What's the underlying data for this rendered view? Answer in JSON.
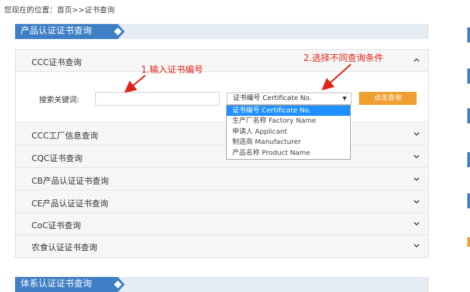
{
  "breadcrumb": {
    "prefix": "您现在的位置：",
    "home": "首页",
    "separator": ">>",
    "current": "证书查询"
  },
  "sections": {
    "product": "产品认证证书查询",
    "system": "体系认证证书查询"
  },
  "accordion": {
    "items": [
      {
        "label": "CCC证书查询",
        "expanded": true
      },
      {
        "label": "CCC工厂信息查询",
        "expanded": false
      },
      {
        "label": "CQC证书查询",
        "expanded": false
      },
      {
        "label": "CB产品认证证书查询",
        "expanded": false
      },
      {
        "label": "CE产品认证证书查询",
        "expanded": false
      },
      {
        "label": "CoC证书查询",
        "expanded": false
      },
      {
        "label": "农食认证证书查询",
        "expanded": false
      }
    ]
  },
  "search": {
    "keyword_label": "搜索关键词:",
    "keyword_value": "",
    "select_value": "证书编号 Certificate No.",
    "button_label": "点击查询",
    "options": [
      "证书编号 Certificate No.",
      "生产厂名称 Factory Name",
      "申请人 Applicant",
      "制造商 Manufacturer",
      "产品名称 Product Name"
    ]
  },
  "annotations": {
    "step1": "1.输入证书编号",
    "step2": "2.选择不同查询条件"
  },
  "colors": {
    "accent_blue": "#3f7fc5",
    "section_bg": "#e4ebf3",
    "button_orange": "#f0a031",
    "selected_option": "#1e90ff",
    "annotation_red": "#e2231a"
  }
}
